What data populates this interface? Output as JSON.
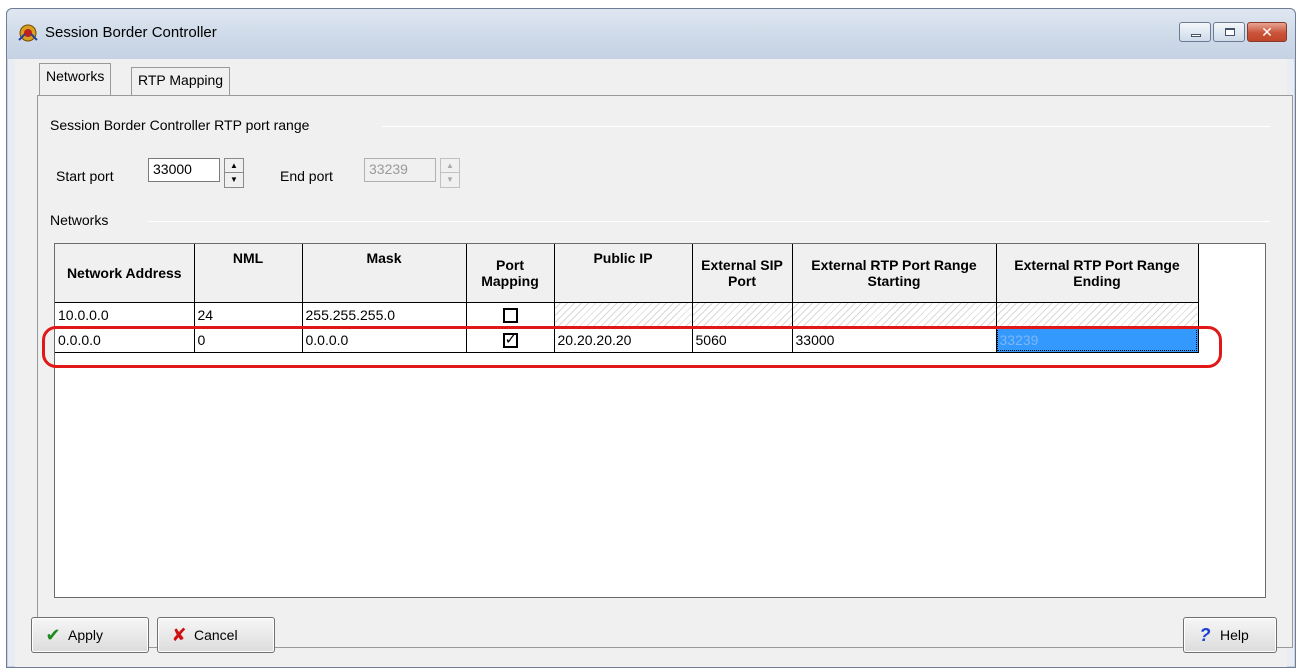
{
  "window": {
    "title": "Session Border Controller"
  },
  "tabs": [
    {
      "label": "Networks",
      "active": true
    },
    {
      "label": "RTP Mapping",
      "active": false
    }
  ],
  "rtp_range": {
    "group_label": "Session Border Controller RTP port range",
    "start_label": "Start port",
    "start_value": "33000",
    "end_label": "End port",
    "end_value": "33239"
  },
  "networks": {
    "group_label": "Networks",
    "columns": [
      "Network Address",
      "NML",
      "Mask",
      "Port Mapping",
      "Public IP",
      "External SIP Port",
      "External RTP Port Range Starting",
      "External RTP Port Range Ending"
    ],
    "rows": [
      {
        "address": "10.0.0.0",
        "nml": "24",
        "mask": "255.255.255.0",
        "port_mapping": false,
        "public_ip": "",
        "sip_port": "",
        "rtp_start": "",
        "rtp_end": ""
      },
      {
        "address": "0.0.0.0",
        "nml": "0",
        "mask": "0.0.0.0",
        "port_mapping": true,
        "public_ip": "20.20.20.20",
        "sip_port": "5060",
        "rtp_start": "33000",
        "rtp_end": "33239"
      }
    ]
  },
  "buttons": {
    "apply": "Apply",
    "cancel": "Cancel",
    "help": "Help"
  },
  "colors": {
    "selection": "#3399ff",
    "highlight_annotation": "#e01818"
  }
}
